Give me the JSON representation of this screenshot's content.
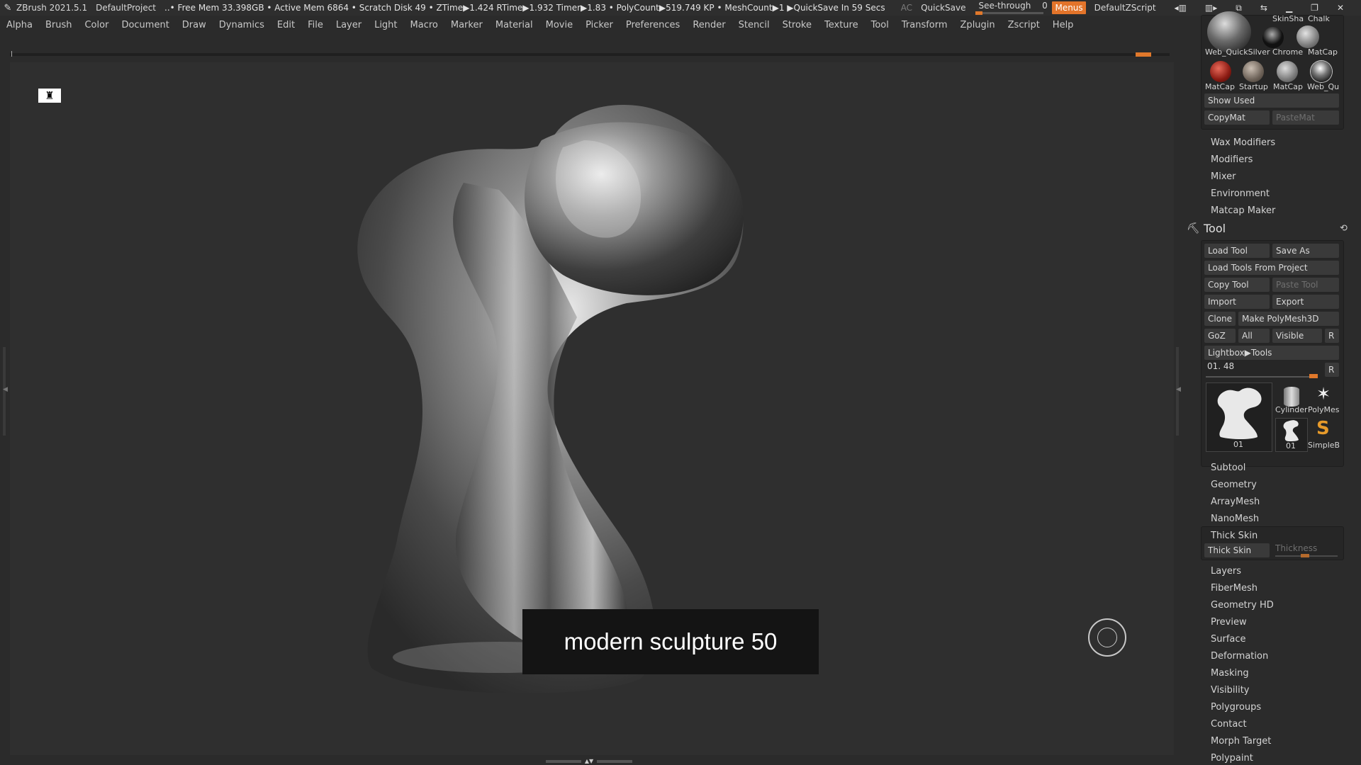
{
  "titlebar": {
    "app": "ZBrush 2021.5.1",
    "project": "DefaultProject",
    "stats": "..• Free Mem 33.398GB • Active Mem 6864 • Scratch Disk 49 •  ZTime▶1.424 RTime▶1.932 Timer▶1.83 • PolyCount▶519.749 KP  • MeshCount▶1  ▶QuickSave In 59 Secs",
    "ac": "AC",
    "quicksave": "QuickSave",
    "see_through_label": "See-through",
    "see_through_value": "0",
    "menus": "Menus",
    "zscript": "DefaultZScript"
  },
  "menubar": [
    "Alpha",
    "Brush",
    "Color",
    "Document",
    "Draw",
    "Dynamics",
    "Edit",
    "File",
    "Layer",
    "Light",
    "Macro",
    "Marker",
    "Material",
    "Movie",
    "Picker",
    "Preferences",
    "Render",
    "Stencil",
    "Stroke",
    "Texture",
    "Tool",
    "Transform",
    "Zplugin",
    "Zscript",
    "Help"
  ],
  "canvas": {
    "caption": "modern sculpture 50"
  },
  "material": {
    "top_labels": [
      "SkinSha",
      "Chalk"
    ],
    "row1": [
      "Web_QuickSilver",
      "Chrome",
      "MatCap"
    ],
    "row2": [
      "MatCap",
      "Startup",
      "MatCap",
      "Web_Qu"
    ],
    "show_used": "Show Used",
    "copymat": "CopyMat",
    "pastemat": "PasteMat"
  },
  "menus_list1": [
    "Wax Modifiers",
    "Modifiers",
    "Mixer",
    "Environment",
    "Matcap Maker"
  ],
  "tool": {
    "title": "Tool",
    "load_tool": "Load Tool",
    "save_as": "Save As",
    "load_from_project": "Load Tools From Project",
    "copy_tool": "Copy Tool",
    "paste_tool": "Paste Tool",
    "import": "Import",
    "export": "Export",
    "clone": "Clone",
    "make_polymesh": "Make PolyMesh3D",
    "goz": "GoZ",
    "all": "All",
    "visible": "Visible",
    "r": "R",
    "lightbox": "Lightbox▶Tools",
    "slider_value": "01. 48",
    "slider_r": "R",
    "thumbs": [
      "01",
      "Cylinder",
      "PolyMes",
      "01",
      "SimpleB"
    ]
  },
  "menus_list2": [
    "Subtool",
    "Geometry",
    "ArrayMesh",
    "NanoMesh",
    "Thick Skin"
  ],
  "thick_skin": {
    "button": "Thick Skin",
    "slider": "Thickness"
  },
  "menus_list3": [
    "Layers",
    "FiberMesh",
    "Geometry HD",
    "Preview",
    "Surface",
    "Deformation",
    "Masking",
    "Visibility",
    "Polygroups",
    "Contact",
    "Morph Target",
    "Polypaint"
  ],
  "colors": {
    "accent": "#e0782b",
    "panel": "#2b2b2b",
    "canvas": "#2f2f2f"
  }
}
